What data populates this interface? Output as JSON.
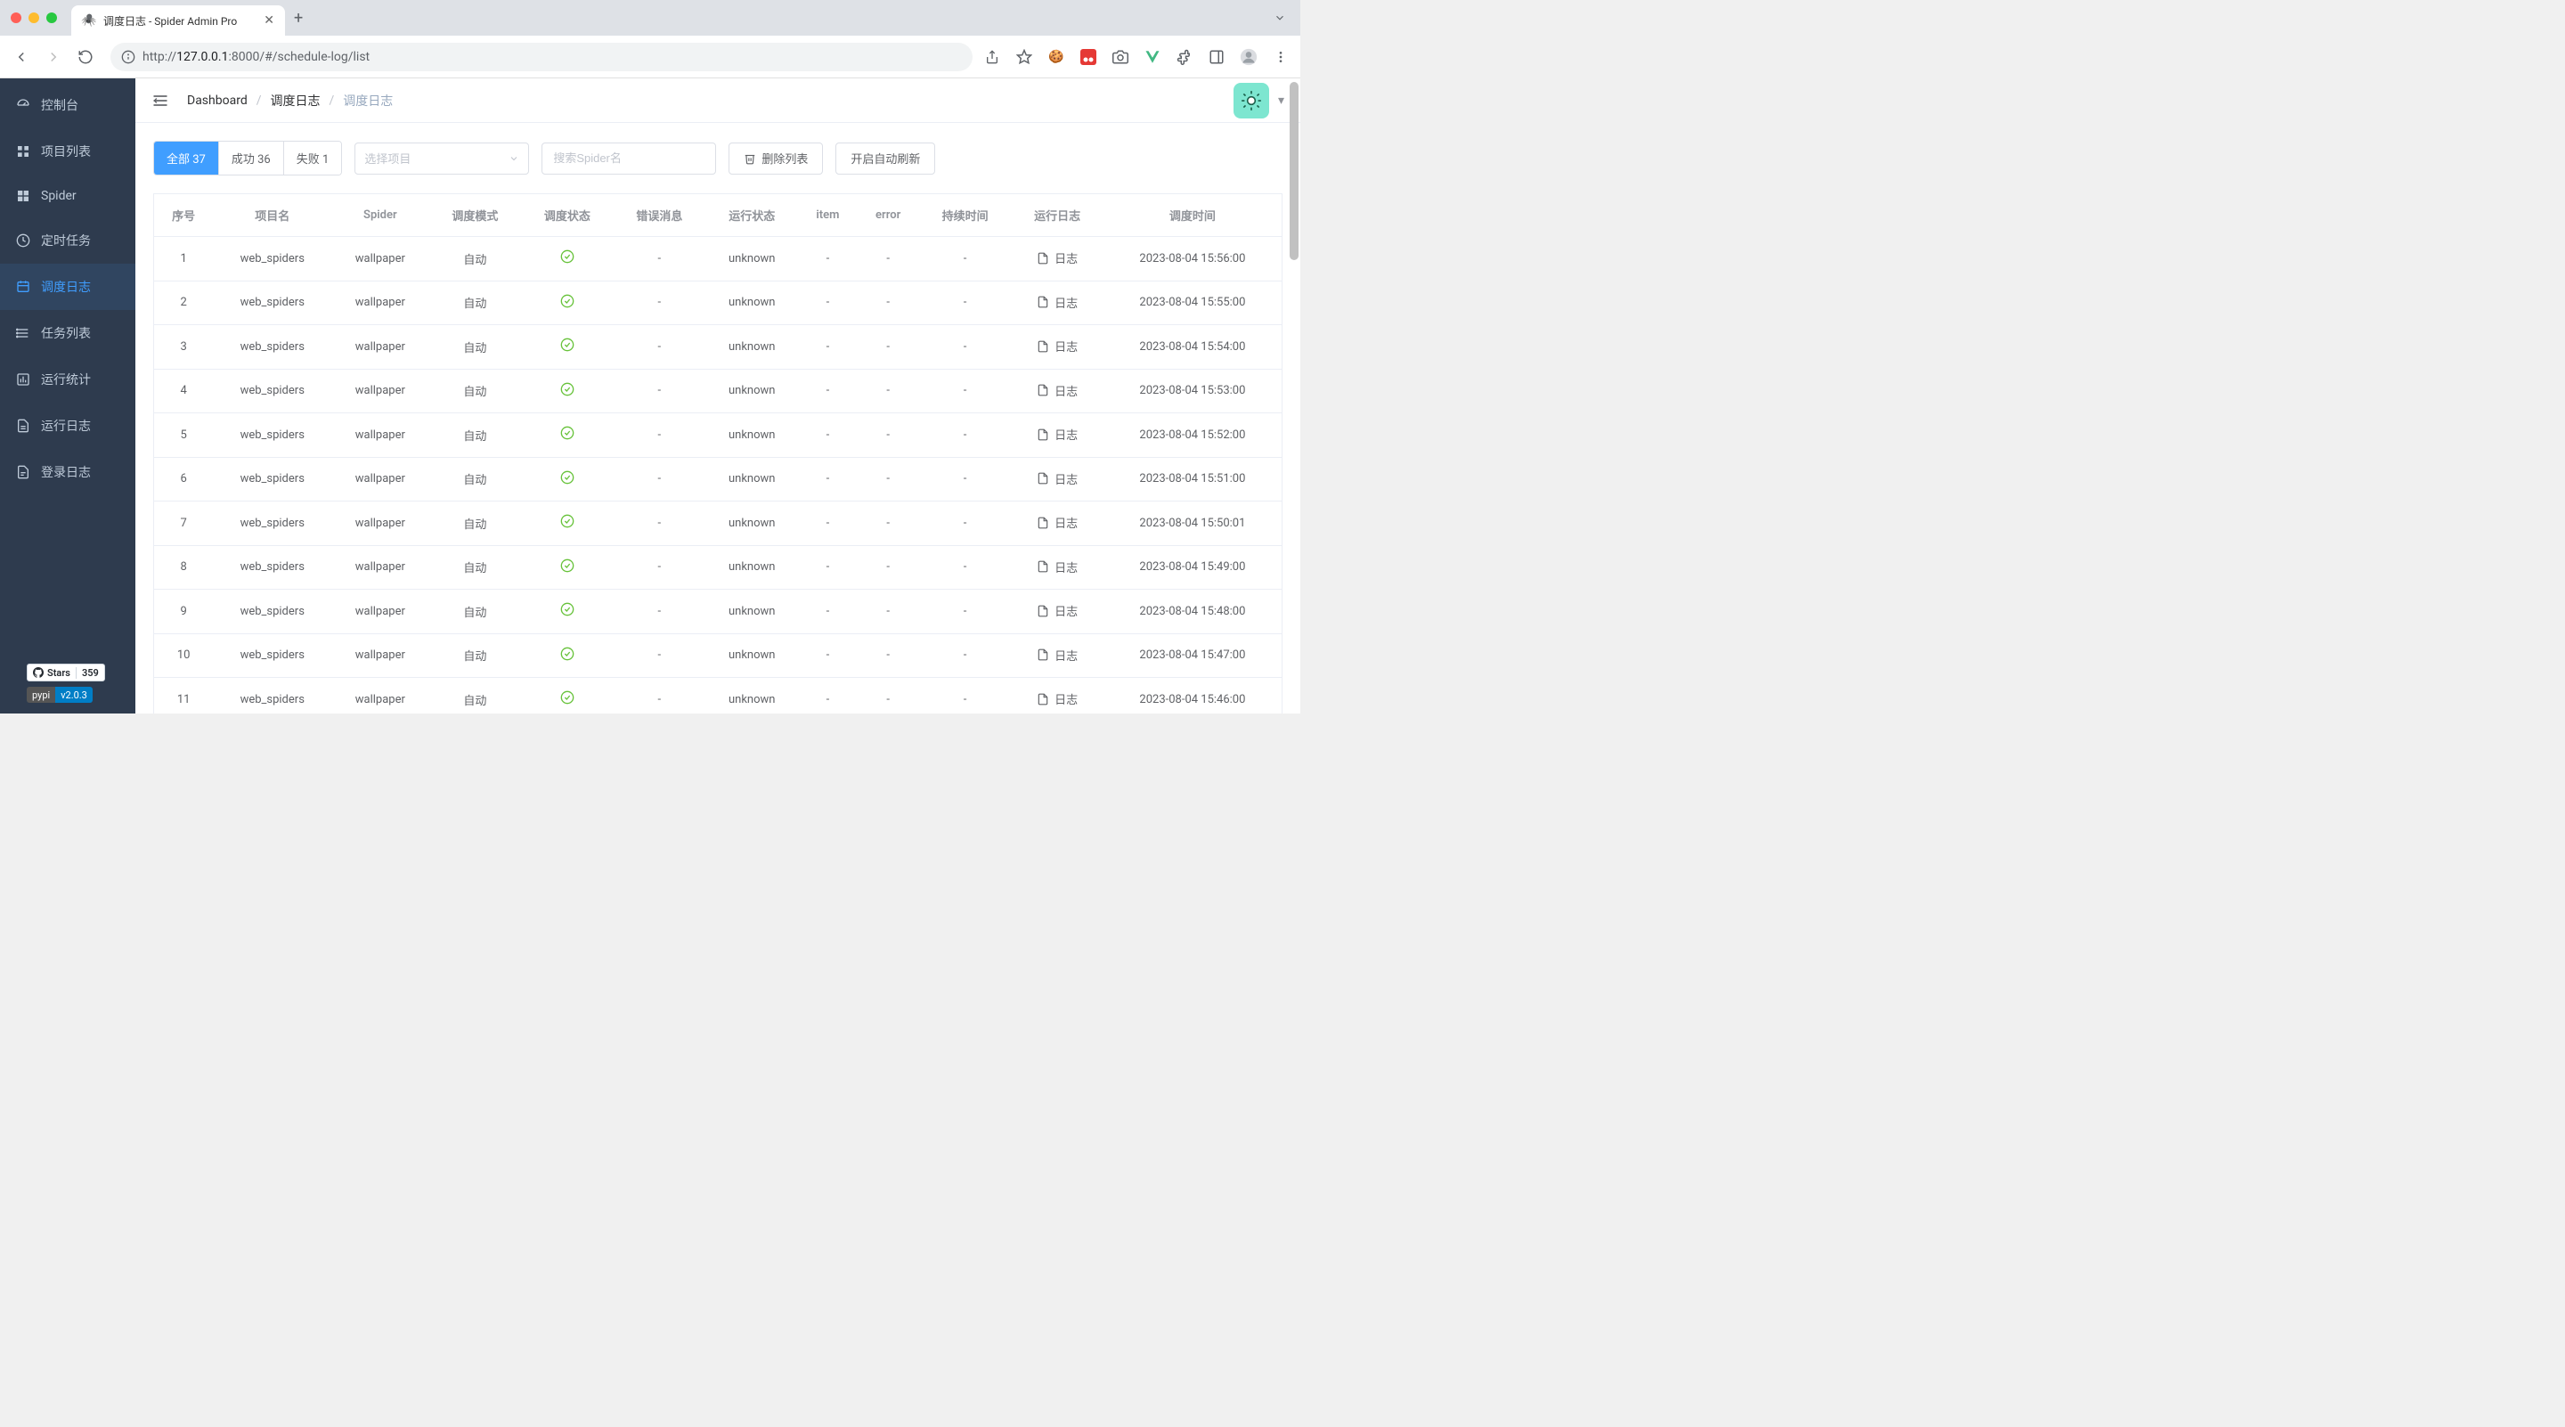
{
  "browser": {
    "tab_title": "调度日志 - Spider Admin Pro",
    "url_protocol": "http://",
    "url_host": "127.0.0.1",
    "url_port": ":8000",
    "url_path": "/#/schedule-log/list"
  },
  "sidebar": {
    "items": [
      {
        "label": "控制台"
      },
      {
        "label": "项目列表"
      },
      {
        "label": "Spider"
      },
      {
        "label": "定时任务"
      },
      {
        "label": "调度日志"
      },
      {
        "label": "任务列表"
      },
      {
        "label": "运行统计"
      },
      {
        "label": "运行日志"
      },
      {
        "label": "登录日志"
      }
    ],
    "github_stars_label": "Stars",
    "github_stars_count": "359",
    "pypi_label": "pypi",
    "pypi_version": "v2.0.3"
  },
  "breadcrumb": {
    "root": "Dashboard",
    "mid": "调度日志",
    "last": "调度日志",
    "sep": "/"
  },
  "filters": {
    "all_label": "全部",
    "all_count": "37",
    "success_label": "成功",
    "success_count": "36",
    "fail_label": "失败",
    "fail_count": "1",
    "project_placeholder": "选择项目",
    "spider_placeholder": "搜索Spider名",
    "clear_btn": "删除列表",
    "auto_refresh_btn": "开启自动刷新"
  },
  "table": {
    "headers": [
      "序号",
      "项目名",
      "Spider",
      "调度模式",
      "调度状态",
      "错误消息",
      "运行状态",
      "item",
      "error",
      "持续时间",
      "运行日志",
      "调度时间"
    ],
    "log_link_label": "日志",
    "rows": [
      {
        "idx": "1",
        "project": "web_spiders",
        "spider": "wallpaper",
        "mode": "自动",
        "err": "-",
        "run": "unknown",
        "item": "-",
        "error": "-",
        "dur": "-",
        "time": "2023-08-04 15:56:00"
      },
      {
        "idx": "2",
        "project": "web_spiders",
        "spider": "wallpaper",
        "mode": "自动",
        "err": "-",
        "run": "unknown",
        "item": "-",
        "error": "-",
        "dur": "-",
        "time": "2023-08-04 15:55:00"
      },
      {
        "idx": "3",
        "project": "web_spiders",
        "spider": "wallpaper",
        "mode": "自动",
        "err": "-",
        "run": "unknown",
        "item": "-",
        "error": "-",
        "dur": "-",
        "time": "2023-08-04 15:54:00"
      },
      {
        "idx": "4",
        "project": "web_spiders",
        "spider": "wallpaper",
        "mode": "自动",
        "err": "-",
        "run": "unknown",
        "item": "-",
        "error": "-",
        "dur": "-",
        "time": "2023-08-04 15:53:00"
      },
      {
        "idx": "5",
        "project": "web_spiders",
        "spider": "wallpaper",
        "mode": "自动",
        "err": "-",
        "run": "unknown",
        "item": "-",
        "error": "-",
        "dur": "-",
        "time": "2023-08-04 15:52:00"
      },
      {
        "idx": "6",
        "project": "web_spiders",
        "spider": "wallpaper",
        "mode": "自动",
        "err": "-",
        "run": "unknown",
        "item": "-",
        "error": "-",
        "dur": "-",
        "time": "2023-08-04 15:51:00"
      },
      {
        "idx": "7",
        "project": "web_spiders",
        "spider": "wallpaper",
        "mode": "自动",
        "err": "-",
        "run": "unknown",
        "item": "-",
        "error": "-",
        "dur": "-",
        "time": "2023-08-04 15:50:01"
      },
      {
        "idx": "8",
        "project": "web_spiders",
        "spider": "wallpaper",
        "mode": "自动",
        "err": "-",
        "run": "unknown",
        "item": "-",
        "error": "-",
        "dur": "-",
        "time": "2023-08-04 15:49:00"
      },
      {
        "idx": "9",
        "project": "web_spiders",
        "spider": "wallpaper",
        "mode": "自动",
        "err": "-",
        "run": "unknown",
        "item": "-",
        "error": "-",
        "dur": "-",
        "time": "2023-08-04 15:48:00"
      },
      {
        "idx": "10",
        "project": "web_spiders",
        "spider": "wallpaper",
        "mode": "自动",
        "err": "-",
        "run": "unknown",
        "item": "-",
        "error": "-",
        "dur": "-",
        "time": "2023-08-04 15:47:00"
      },
      {
        "idx": "11",
        "project": "web_spiders",
        "spider": "wallpaper",
        "mode": "自动",
        "err": "-",
        "run": "unknown",
        "item": "-",
        "error": "-",
        "dur": "-",
        "time": "2023-08-04 15:46:00"
      }
    ]
  }
}
